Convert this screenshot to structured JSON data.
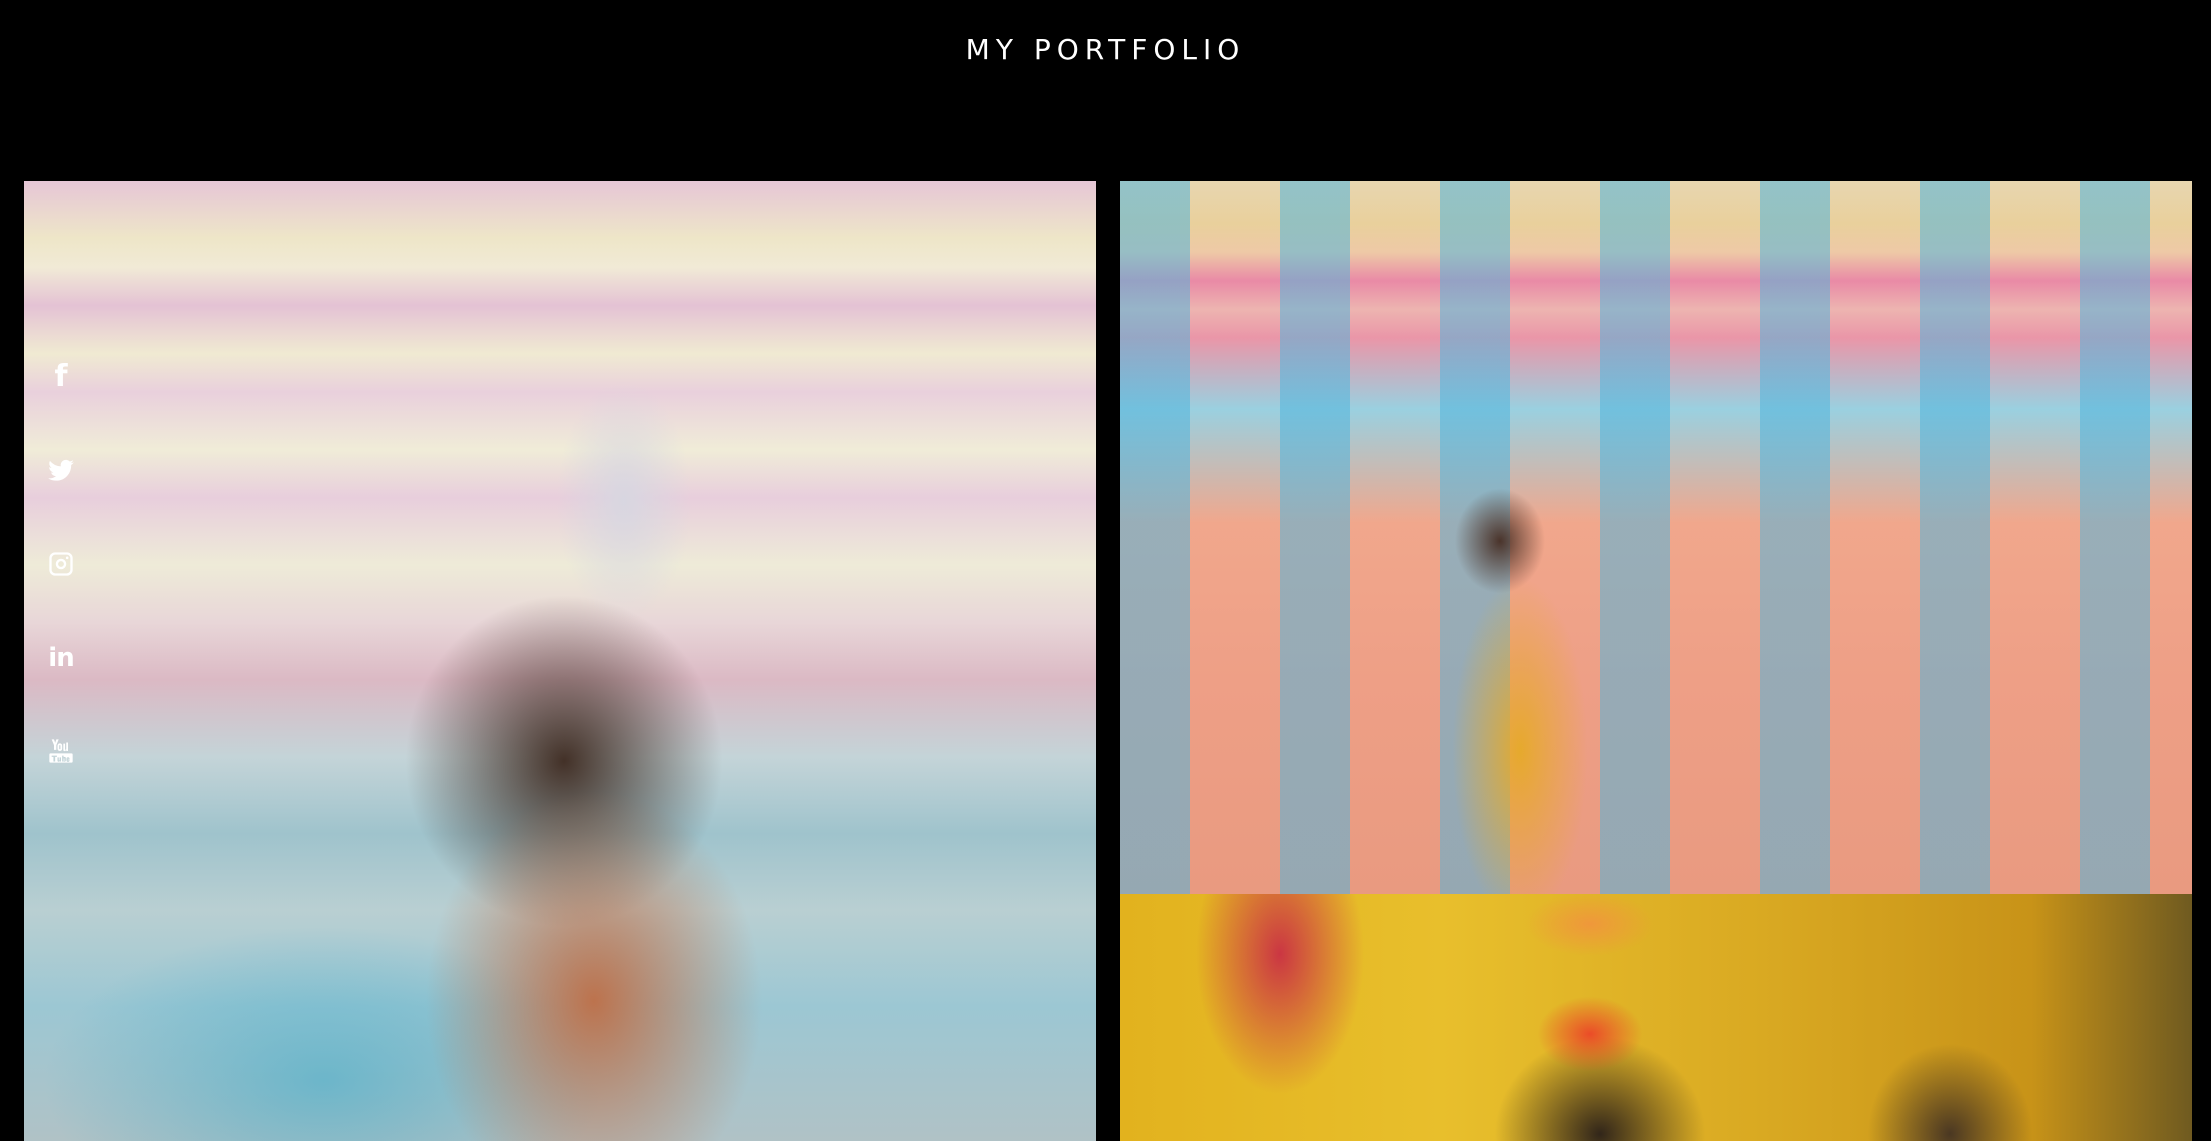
{
  "header": {
    "title": "MY PORTFOLIO"
  },
  "social": {
    "items": [
      {
        "name": "facebook",
        "icon": "facebook-icon"
      },
      {
        "name": "twitter",
        "icon": "twitter-icon"
      },
      {
        "name": "instagram",
        "icon": "instagram-icon"
      },
      {
        "name": "linkedin",
        "icon": "linkedin-icon"
      },
      {
        "name": "youtube",
        "icon": "youtube-icon"
      }
    ]
  },
  "gallery": {
    "photos": [
      {
        "subject": "bride-portrait-closeup"
      },
      {
        "subject": "bride-standing-draped-background"
      },
      {
        "subject": "bride-haldi-ceremony"
      }
    ]
  },
  "colors": {
    "background": "#000000",
    "text": "#ffffff"
  }
}
